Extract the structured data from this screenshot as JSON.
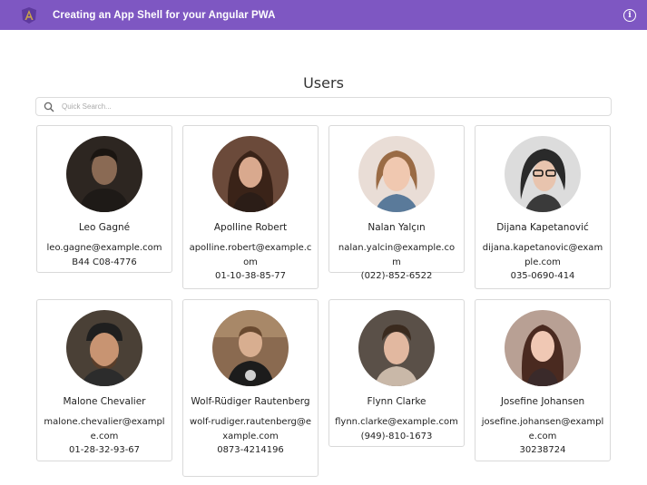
{
  "header": {
    "title": "Creating an App Shell for your Angular PWA",
    "info_icon": "i"
  },
  "page": {
    "title": "Users"
  },
  "search": {
    "placeholder": "Quick Search..."
  },
  "colors": {
    "toolbar": "#7e57c2",
    "card_border": "#d9d9d9"
  },
  "users": [
    {
      "name": "Leo Gagné",
      "email": "leo.gagne@example.com",
      "phone": "B44 C08-4776"
    },
    {
      "name": "Apolline Robert",
      "email": "apolline.robert@example.com",
      "phone": "01-10-38-85-77"
    },
    {
      "name": "Nalan Yalçın",
      "email": "nalan.yalcin@example.com",
      "phone": "(022)-852-6522"
    },
    {
      "name": "Dijana Kapetanović",
      "email": "dijana.kapetanovic@example.com",
      "phone": "035-0690-414"
    },
    {
      "name": "Malone Chevalier",
      "email": "malone.chevalier@example.com",
      "phone": "01-28-32-93-67"
    },
    {
      "name": "Wolf-Rüdiger Rautenberg",
      "email": "wolf-rudiger.rautenberg@example.com",
      "phone": "0873-4214196"
    },
    {
      "name": "Flynn Clarke",
      "email": "flynn.clarke@example.com",
      "phone": "(949)-810-1673"
    },
    {
      "name": "Josefine Johansen",
      "email": "josefine.johansen@example.com",
      "phone": "30238724"
    }
  ]
}
